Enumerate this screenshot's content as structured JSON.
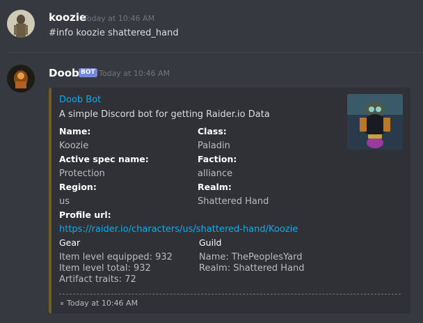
{
  "messages": [
    {
      "username": "koozie",
      "timestamp": "Today at 10:46 AM",
      "text": "#info koozie shattered_hand",
      "avatar_icon": "user-avatar"
    },
    {
      "username": "Doob",
      "bot_tag": "BOT",
      "timestamp": "Today at 10:46 AM",
      "avatar_icon": "bot-avatar"
    }
  ],
  "embed": {
    "accent_color": "#6d5f1e",
    "title": "Doob Bot",
    "description": "A simple Discord bot for getting Raider.io Data",
    "fields": [
      {
        "name": "Name:",
        "value": "Koozie"
      },
      {
        "name": "Class:",
        "value": "Paladin"
      },
      {
        "name": "Active spec name:",
        "value": "Protection"
      },
      {
        "name": "Faction:",
        "value": "alliance"
      },
      {
        "name": "Region:",
        "value": "us"
      },
      {
        "name": "Realm:",
        "value": "Shattered Hand"
      },
      {
        "name": "Profile url:",
        "value": "https://raider.io/characters/us/shattered-hand/Koozie"
      },
      {
        "name": "Gear",
        "lines": [
          "Item level equipped: 932",
          "Item level total: 932",
          "Artifact traits: 72"
        ]
      },
      {
        "name": "Guild",
        "lines": [
          "Name: ThePeoplesYard",
          "Realm: Shattered Hand"
        ]
      }
    ],
    "thumbnail_icon": "character-thumbnail",
    "footer": "Today at 10:46 AM"
  },
  "colors": {
    "background": "#36393f",
    "embed_bg": "#2f3136",
    "link": "#00b0f4",
    "bot_tag": "#7289da"
  }
}
